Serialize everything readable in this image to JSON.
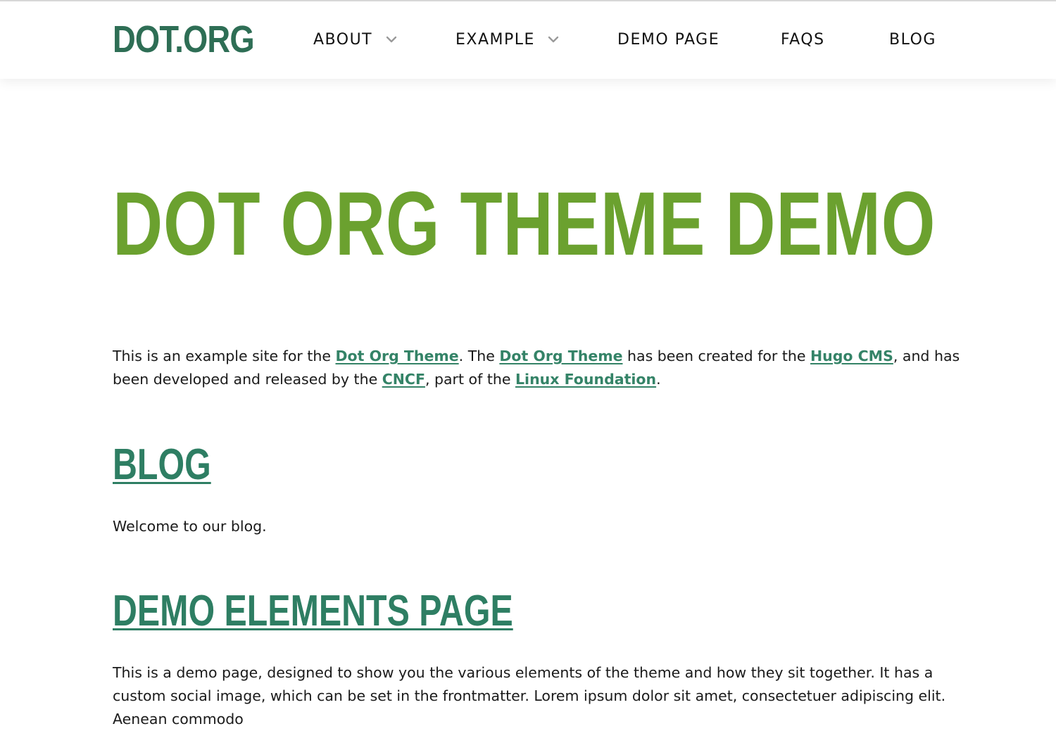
{
  "header": {
    "logo": "DOT.ORG",
    "nav": [
      {
        "label": "ABOUT",
        "has_dropdown": true
      },
      {
        "label": "EXAMPLE",
        "has_dropdown": true
      },
      {
        "label": "DEMO PAGE",
        "has_dropdown": false
      },
      {
        "label": "FAQS",
        "has_dropdown": false
      },
      {
        "label": "BLOG",
        "has_dropdown": false
      }
    ]
  },
  "main": {
    "title": "DOT ORG THEME DEMO",
    "intro": {
      "t1": "This is an example site for the ",
      "link1": "Dot Org Theme",
      "t2": ". The ",
      "link2": "Dot Org Theme",
      "t3": " has been created for the ",
      "link3": "Hugo CMS",
      "t4": ", and has been developed and released by the ",
      "link4": "CNCF",
      "t5": ", part of the ",
      "link5": "Linux Foundation",
      "t6": "."
    },
    "sections": [
      {
        "title": "BLOG",
        "summary": "Welcome to our blog."
      },
      {
        "title": "DEMO ELEMENTS PAGE",
        "summary": "This is a demo page, designed to show you the various elements of the theme and how they sit together. It has a custom social image, which can be set in the frontmatter. Lorem ipsum dolor sit amet, consectetuer adipiscing elit. Aenean commodo"
      }
    ]
  },
  "colors": {
    "logo": "#2e6e55",
    "hero_title": "#6ba12f",
    "link": "#348367",
    "section_link": "#2e7e63",
    "text": "#1a1a1a"
  },
  "icons": {
    "dropdown": "chevron-down-icon"
  }
}
